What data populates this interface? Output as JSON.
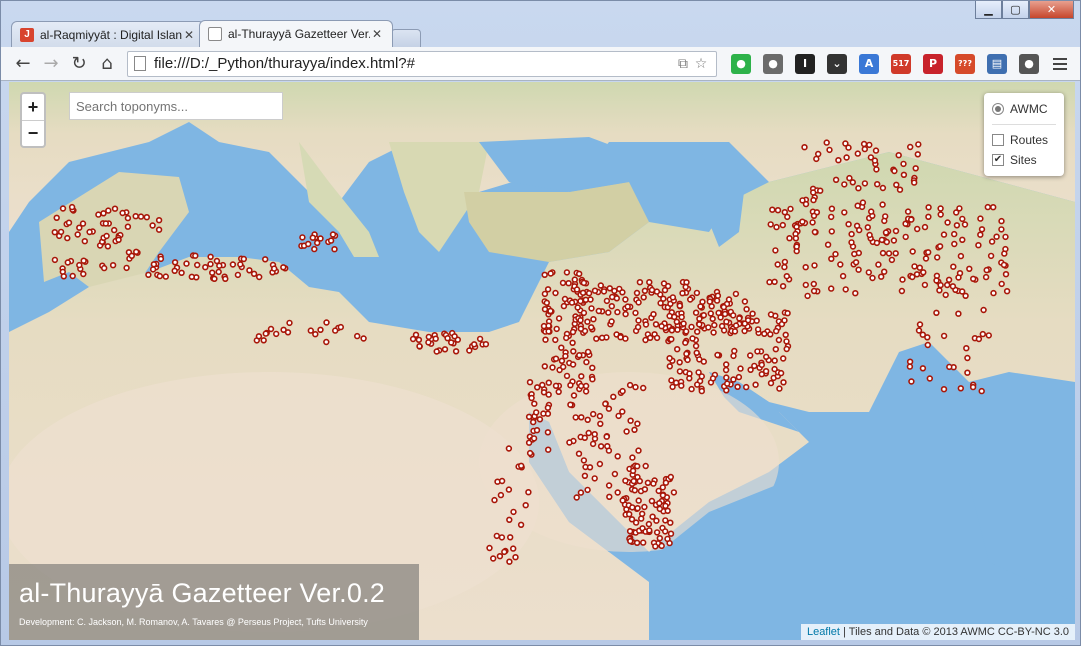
{
  "browser": {
    "tabs": [
      {
        "title": "al-Raqmiyyāt : Digital Islan",
        "favicon": "red-logo-icon",
        "active": false
      },
      {
        "title": "al-Thurayyā Gazetteer Ver.",
        "favicon": "page-icon",
        "active": true
      }
    ],
    "address": "file:///D:/_Python/thurayya/index.html?#",
    "extensions": [
      {
        "name": "evernote-icon",
        "color": "#2db24a",
        "glyph": "●"
      },
      {
        "name": "adblock-icon",
        "color": "#6b6b6b",
        "glyph": "●"
      },
      {
        "name": "instapaper-icon",
        "color": "#222222",
        "glyph": "I"
      },
      {
        "name": "pocket-icon",
        "color": "#333333",
        "glyph": "⌄"
      },
      {
        "name": "translate-icon",
        "color": "#3a78d6",
        "glyph": "A"
      },
      {
        "name": "tool-badge-icon",
        "color": "#d03a2a",
        "glyph": "517"
      },
      {
        "name": "pinterest-icon",
        "color": "#c8232c",
        "glyph": "P"
      },
      {
        "name": "todo-badge-icon",
        "color": "#d64a2a",
        "glyph": "???"
      },
      {
        "name": "book-icon",
        "color": "#3f6fb0",
        "glyph": "▤"
      },
      {
        "name": "elephant-icon",
        "color": "#555555",
        "glyph": "●"
      }
    ]
  },
  "map": {
    "search_placeholder": "Search toponyms...",
    "zoom_in": "+",
    "zoom_out": "−",
    "layers": {
      "base": "AWMC",
      "overlays": [
        {
          "label": "Routes",
          "checked": false
        },
        {
          "label": "Sites",
          "checked": true
        }
      ]
    },
    "title": "al-Thurayyā Gazetteer Ver.0.2",
    "credits": "Development: C. Jackson, M. Romanov, A. Tavares @ Perseus Project, Tufts University",
    "attribution_link": "Leaflet",
    "attribution_text": " | Tiles and Data © 2013 AWMC CC-BY-NC 3.0",
    "colors": {
      "sea": "#7fb6e3",
      "land": "#ead9c6",
      "site": "#a81608"
    }
  }
}
